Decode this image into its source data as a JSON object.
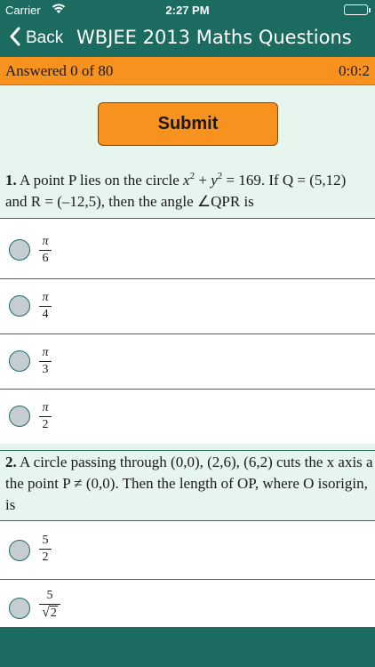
{
  "status_bar": {
    "carrier": "Carrier",
    "time": "2:27 PM"
  },
  "nav": {
    "back_label": "Back",
    "title": "WBJEE 2013 Maths Questions"
  },
  "progress": {
    "answered": "Answered 0 of 80",
    "timer": "0:0:2"
  },
  "submit_label": "Submit",
  "questions": [
    {
      "number": "1.",
      "text_a": " A point P lies on the circle ",
      "x": "x",
      "exp_x": "2",
      "plus": " + ",
      "y": "y",
      "exp_y": "2",
      "text_b": " = 169. If Q = (5,12) and R = (–12,5), then the angle ∠QPR is",
      "options": [
        {
          "num": "π",
          "den": "6"
        },
        {
          "num": "π",
          "den": "4"
        },
        {
          "num": "π",
          "den": "3"
        },
        {
          "num": "π",
          "den": "2"
        }
      ]
    },
    {
      "number": "2.",
      "text": " A circle passing through (0,0), (2,6), (6,2) cuts the x axis a the point P ≠ (0,0). Then the length of OP, where O isorigin, is",
      "options": [
        {
          "num": "5",
          "den": "2"
        },
        {
          "num": "5",
          "sqrt_sign": "√",
          "sqrt_arg": "2"
        }
      ]
    }
  ]
}
